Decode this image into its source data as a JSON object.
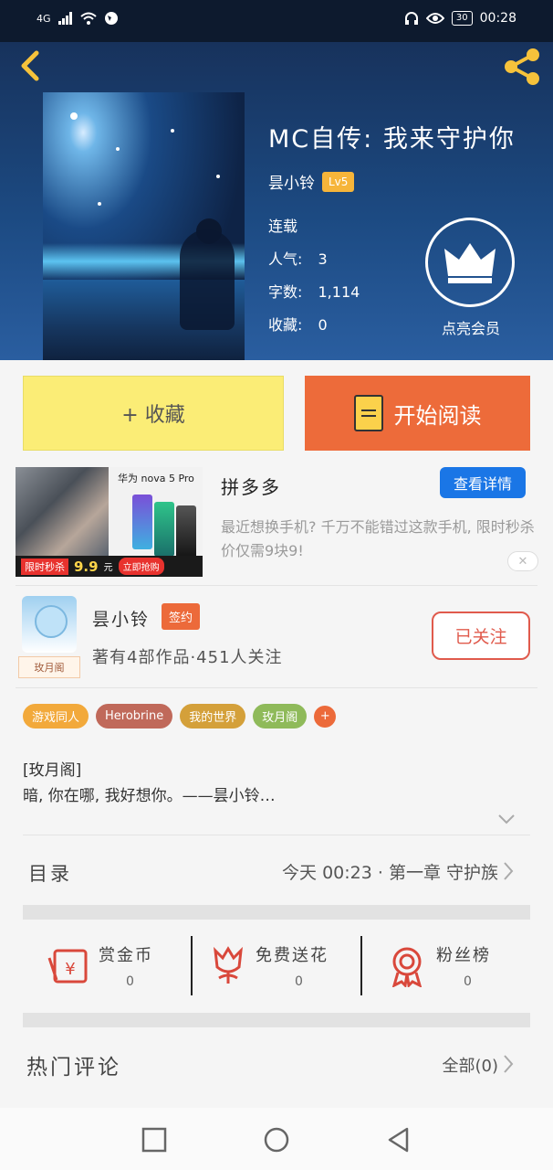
{
  "status_bar": {
    "network": "4G",
    "battery": "30",
    "time": "00:28"
  },
  "book": {
    "title": "MC自传: 我来守护你",
    "author": "昙小铃",
    "level": "Lv5",
    "status": "连载",
    "popularity_label": "人气:",
    "popularity": "3",
    "words_label": "字数:",
    "words": "1,114",
    "favorites_label": "收藏:",
    "favorites": "0",
    "vip_label": "点亮会员"
  },
  "actions": {
    "collect": "+ 收藏",
    "read": "开始阅读"
  },
  "ad": {
    "image_title": "华为 nova 5 Pro",
    "flash_text": "限时秒杀",
    "price": "9.9",
    "price_unit": "元",
    "buy_text": "立即抢购",
    "brand": "拼多多",
    "detail_button": "查看详情",
    "description": "最近想换手机? 千万不能错过这款手机, 限时秒杀价仅需9块9!"
  },
  "author_card": {
    "name": "昙小铃",
    "signed": "签约",
    "tag": "玫月阁",
    "stats": "著有4部作品·451人关注",
    "follow_button": "已关注"
  },
  "tags": [
    {
      "label": "游戏同人",
      "color": "#f2a93b"
    },
    {
      "label": "Herobrine",
      "color": "#c0695a"
    },
    {
      "label": "我的世界",
      "color": "#d4a03a"
    },
    {
      "label": "玫月阁",
      "color": "#8fba5a"
    }
  ],
  "tag_more": "+",
  "intro": {
    "title": "[玫月阁]",
    "text": "暗, 你在哪, 我好想你。——昙小铃…"
  },
  "catalog": {
    "label": "目录",
    "latest": "今天 00:23 · 第一章  守护族"
  },
  "rewards": [
    {
      "label": "赏金币",
      "count": "0",
      "icon": "red-envelope-icon"
    },
    {
      "label": "免费送花",
      "count": "0",
      "icon": "flower-icon"
    },
    {
      "label": "粉丝榜",
      "count": "0",
      "icon": "medal-icon"
    }
  ],
  "comments": {
    "label": "热门评论",
    "all": "全部(0)"
  },
  "colors": {
    "accent_orange": "#ed6b3a",
    "accent_yellow": "#fbed76",
    "header_blue": "#1c4a82",
    "ad_blue": "#1a76e6"
  }
}
